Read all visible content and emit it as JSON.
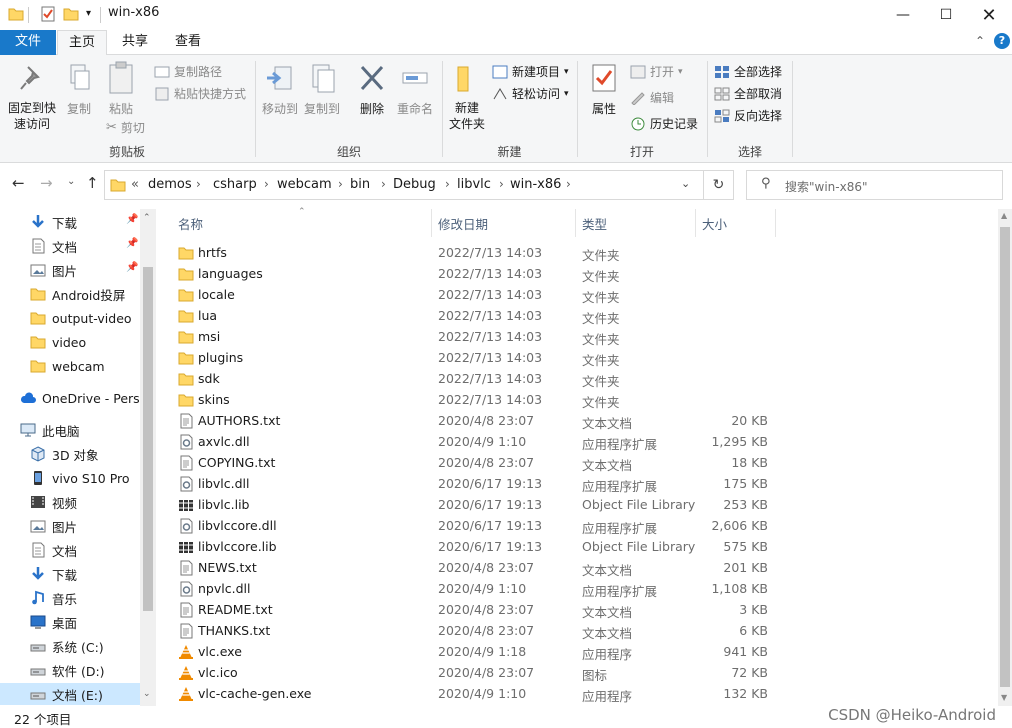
{
  "window": {
    "title": "win-x86"
  },
  "ribbon_tabs": [
    "文件",
    "主页",
    "共享",
    "查看"
  ],
  "ribbon": {
    "clipboard": {
      "pin": "固定到快\n速访问",
      "copy": "复制",
      "paste": "粘贴",
      "copy_path": "复制路径",
      "paste_shortcut": "粘贴快捷方式",
      "cut": "剪切",
      "label": "剪贴板"
    },
    "organize": {
      "move_to": "移动到",
      "copy_to": "复制到",
      "delete": "删除",
      "rename": "重命名",
      "label": "组织"
    },
    "new": {
      "new_folder": "新建\n文件夹",
      "new_item": "新建项目",
      "easy_access": "轻松访问",
      "label": "新建"
    },
    "open": {
      "properties": "属性",
      "open": "打开",
      "edit": "编辑",
      "history": "历史记录",
      "label": "打开"
    },
    "select": {
      "select_all": "全部选择",
      "select_none": "全部取消",
      "invert": "反向选择",
      "label": "选择"
    }
  },
  "address": {
    "overflow": "«",
    "crumbs": [
      "demos",
      "csharp",
      "webcam",
      "bin",
      "Debug",
      "libvlc",
      "win-x86"
    ],
    "search_placeholder": "搜索\"win-x86\""
  },
  "nav": [
    {
      "label": "下载",
      "icon": "download-icon",
      "pinned": true
    },
    {
      "label": "文档",
      "icon": "document-icon",
      "pinned": true
    },
    {
      "label": "图片",
      "icon": "picture-icon",
      "pinned": true
    },
    {
      "label": "Android投屏",
      "icon": "folder-icon"
    },
    {
      "label": "output-video",
      "icon": "folder-icon"
    },
    {
      "label": "video",
      "icon": "folder-icon"
    },
    {
      "label": "webcam",
      "icon": "folder-icon"
    },
    {
      "label": "OneDrive - Perso",
      "icon": "cloud-icon"
    },
    {
      "label": "此电脑",
      "icon": "computer-icon"
    },
    {
      "label": "3D 对象",
      "icon": "cube-icon"
    },
    {
      "label": "vivo S10 Pro",
      "icon": "phone-icon"
    },
    {
      "label": "视频",
      "icon": "video-icon"
    },
    {
      "label": "图片",
      "icon": "picture-icon"
    },
    {
      "label": "文档",
      "icon": "document-icon"
    },
    {
      "label": "下载",
      "icon": "download-icon"
    },
    {
      "label": "音乐",
      "icon": "music-icon"
    },
    {
      "label": "桌面",
      "icon": "desktop-icon"
    },
    {
      "label": "系统 (C:)",
      "icon": "drive-icon"
    },
    {
      "label": "软件 (D:)",
      "icon": "drive-icon"
    },
    {
      "label": "文档 (E:)",
      "icon": "drive-icon",
      "selected": true
    }
  ],
  "columns": {
    "name": "名称",
    "date": "修改日期",
    "type": "类型",
    "size": "大小"
  },
  "files": [
    {
      "name": "hrtfs",
      "date": "2022/7/13 14:03",
      "type": "文件夹",
      "size": "",
      "icon": "folder-icon"
    },
    {
      "name": "languages",
      "date": "2022/7/13 14:03",
      "type": "文件夹",
      "size": "",
      "icon": "folder-icon"
    },
    {
      "name": "locale",
      "date": "2022/7/13 14:03",
      "type": "文件夹",
      "size": "",
      "icon": "folder-icon"
    },
    {
      "name": "lua",
      "date": "2022/7/13 14:03",
      "type": "文件夹",
      "size": "",
      "icon": "folder-icon"
    },
    {
      "name": "msi",
      "date": "2022/7/13 14:03",
      "type": "文件夹",
      "size": "",
      "icon": "folder-icon"
    },
    {
      "name": "plugins",
      "date": "2022/7/13 14:03",
      "type": "文件夹",
      "size": "",
      "icon": "folder-icon"
    },
    {
      "name": "sdk",
      "date": "2022/7/13 14:03",
      "type": "文件夹",
      "size": "",
      "icon": "folder-icon"
    },
    {
      "name": "skins",
      "date": "2022/7/13 14:03",
      "type": "文件夹",
      "size": "",
      "icon": "folder-icon"
    },
    {
      "name": "AUTHORS.txt",
      "date": "2020/4/8 23:07",
      "type": "文本文档",
      "size": "20 KB",
      "icon": "text-file-icon"
    },
    {
      "name": "axvlc.dll",
      "date": "2020/4/9 1:10",
      "type": "应用程序扩展",
      "size": "1,295 KB",
      "icon": "dll-icon"
    },
    {
      "name": "COPYING.txt",
      "date": "2020/4/8 23:07",
      "type": "文本文档",
      "size": "18 KB",
      "icon": "text-file-icon"
    },
    {
      "name": "libvlc.dll",
      "date": "2020/6/17 19:13",
      "type": "应用程序扩展",
      "size": "175 KB",
      "icon": "dll-icon"
    },
    {
      "name": "libvlc.lib",
      "date": "2020/6/17 19:13",
      "type": "Object File Library",
      "size": "253 KB",
      "icon": "lib-icon"
    },
    {
      "name": "libvlccore.dll",
      "date": "2020/6/17 19:13",
      "type": "应用程序扩展",
      "size": "2,606 KB",
      "icon": "dll-icon"
    },
    {
      "name": "libvlccore.lib",
      "date": "2020/6/17 19:13",
      "type": "Object File Library",
      "size": "575 KB",
      "icon": "lib-icon"
    },
    {
      "name": "NEWS.txt",
      "date": "2020/4/8 23:07",
      "type": "文本文档",
      "size": "201 KB",
      "icon": "text-file-icon"
    },
    {
      "name": "npvlc.dll",
      "date": "2020/4/9 1:10",
      "type": "应用程序扩展",
      "size": "1,108 KB",
      "icon": "dll-icon"
    },
    {
      "name": "README.txt",
      "date": "2020/4/8 23:07",
      "type": "文本文档",
      "size": "3 KB",
      "icon": "text-file-icon"
    },
    {
      "name": "THANKS.txt",
      "date": "2020/4/8 23:07",
      "type": "文本文档",
      "size": "6 KB",
      "icon": "text-file-icon"
    },
    {
      "name": "vlc.exe",
      "date": "2020/4/9 1:18",
      "type": "应用程序",
      "size": "941 KB",
      "icon": "vlc-cone-icon"
    },
    {
      "name": "vlc.ico",
      "date": "2020/4/8 23:07",
      "type": "图标",
      "size": "72 KB",
      "icon": "vlc-cone-icon"
    },
    {
      "name": "vlc-cache-gen.exe",
      "date": "2020/4/9 1:10",
      "type": "应用程序",
      "size": "132 KB",
      "icon": "vlc-cone-icon"
    }
  ],
  "status": {
    "count": "22 个项目",
    "watermark": "CSDN @Heiko-Android"
  },
  "colors": {
    "accent": "#1979ca",
    "folder": "#ffd766",
    "vlc": "#f08a00"
  }
}
